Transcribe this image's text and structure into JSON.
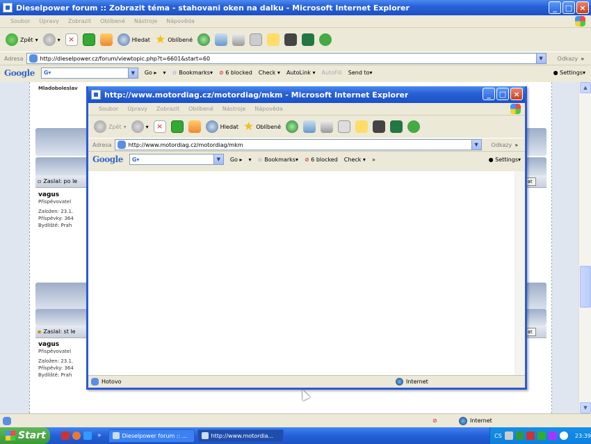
{
  "main_window": {
    "title": "Dieselpower forum :: Zobrazit téma - stahovani oken na dalku - Microsoft Internet Explorer",
    "menu": [
      "Soubor",
      "Úpravy",
      "Zobrazit",
      "Oblíbené",
      "Nástroje",
      "Nápověda"
    ],
    "toolbar": {
      "back": "Zpět",
      "search": "Hledat",
      "favorites": "Oblíbené"
    },
    "address": {
      "label": "Adresa",
      "url": "http://dieselpower.cz/forum/viewtopic.php?t=6601&start=60",
      "links": "Odkazy"
    },
    "google": {
      "logo": "Google",
      "go": "Go",
      "bookmarks": "Bookmarks",
      "blocked": "6 blocked",
      "check": "Check",
      "autolink": "AutoLink",
      "autofill": "AutoFill",
      "sendto": "Send to",
      "settings": "Settings"
    },
    "status": {
      "zone": "Internet"
    }
  },
  "forum": {
    "top_text": "Mladoboleslav",
    "posts": [
      {
        "header": "Zaslal: po le",
        "user": "vagus",
        "rank": "Přispěvovatel",
        "joined": "Založen: 23.1.",
        "posts": "Příspěvky: 364",
        "location": "Bydliště: Prah",
        "quote": "vat"
      },
      {
        "header": "Zaslal: st le",
        "user": "vagus",
        "rank": "Přispěvovatel",
        "joined": "Založen: 23.1.",
        "posts": "Příspěvky: 364",
        "location": "Bydliště: Prah",
        "quote": "vat"
      }
    ]
  },
  "popup": {
    "title": "http://www.motordiag.cz/motordiag/mkm - Microsoft Internet Explorer",
    "menu": [
      "Soubor",
      "Úpravy",
      "Zobrazit",
      "Oblíbené",
      "Nástroje",
      "Nápověda"
    ],
    "toolbar": {
      "back": "Zpět",
      "search": "Hledat",
      "favorites": "Oblíbené"
    },
    "address": {
      "label": "Adresa",
      "url": "http://www.motordiag.cz/motordiag/mkm",
      "links": "Odkazy"
    },
    "google": {
      "logo": "Google",
      "go": "Go",
      "bookmarks": "Bookmarks",
      "blocked": "6 blocked",
      "check": "Check",
      "settings": "Settings"
    },
    "status": {
      "text": "Hotovo",
      "zone": "Internet"
    }
  },
  "taskbar": {
    "start": "Start",
    "tasks": [
      "Dieselpower forum :: ...",
      "http://www.motordia..."
    ],
    "lang": "CS",
    "clock": "23:39"
  },
  "colors": {
    "xp_blue": "#2a62d6",
    "taskbar": "#2360d8",
    "start_green": "#3a9b34",
    "page_bg": "#dfe6f0"
  }
}
